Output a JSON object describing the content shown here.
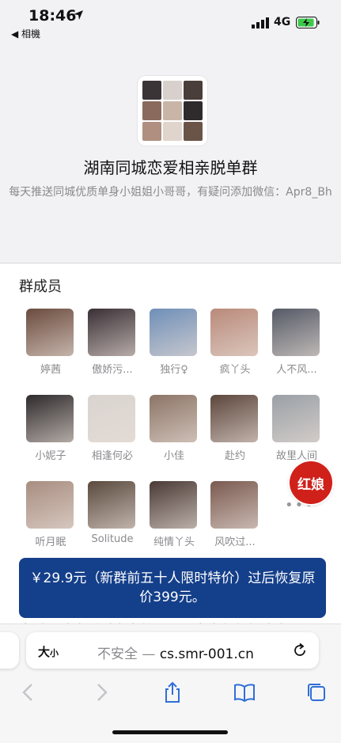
{
  "status_bar": {
    "time": "18:46",
    "back_label": "◀ 相機",
    "network": "4G"
  },
  "group": {
    "name": "湖南同城恋爱相亲脱单群",
    "description": "每天推送同城优质单身小姐姐小哥哥，有疑问添加微信：Apr8_Bh"
  },
  "members_title": "群成员",
  "members": [
    {
      "name": "婷茜",
      "color": "#6b4b3e"
    },
    {
      "name": "傲娇污...",
      "color": "#3a2f35"
    },
    {
      "name": "独行♀",
      "color": "#6f8fb8"
    },
    {
      "name": "疯丫头",
      "color": "#b98a7a"
    },
    {
      "name": "人不风...",
      "color": "#555a66"
    },
    {
      "name": "小妮子",
      "color": "#2e2a2c"
    },
    {
      "name": "相逢何必",
      "color": "#d9d4d0"
    },
    {
      "name": "小佳",
      "color": "#8c7466"
    },
    {
      "name": "赴约",
      "color": "#5c463c"
    },
    {
      "name": "故里人间",
      "color": "#9aa0a6"
    },
    {
      "name": "听月眠",
      "color": "#a88d80"
    },
    {
      "name": "Solitude",
      "color": "#5a4a3e"
    },
    {
      "name": "纯情丫头",
      "color": "#4a3a35"
    },
    {
      "name": "风吹过...",
      "color": "#7a5a50"
    }
  ],
  "more_dots": "•••",
  "badge_label": "红娘",
  "banner_text": "￥29.9元（新群前五十人限时特价）过后恢复原价399元。",
  "peek_text": "恋爱，请今适对方身份，不要发生任何经济来",
  "browser": {
    "aa_label": "大",
    "aa_small": "小",
    "insecure_label": "不安全 — ",
    "url": "cs.smr-001.cn"
  },
  "colors": {
    "banner": "#143f8a",
    "badge": "#d0201a",
    "header_bg": "#f2f2f4"
  }
}
